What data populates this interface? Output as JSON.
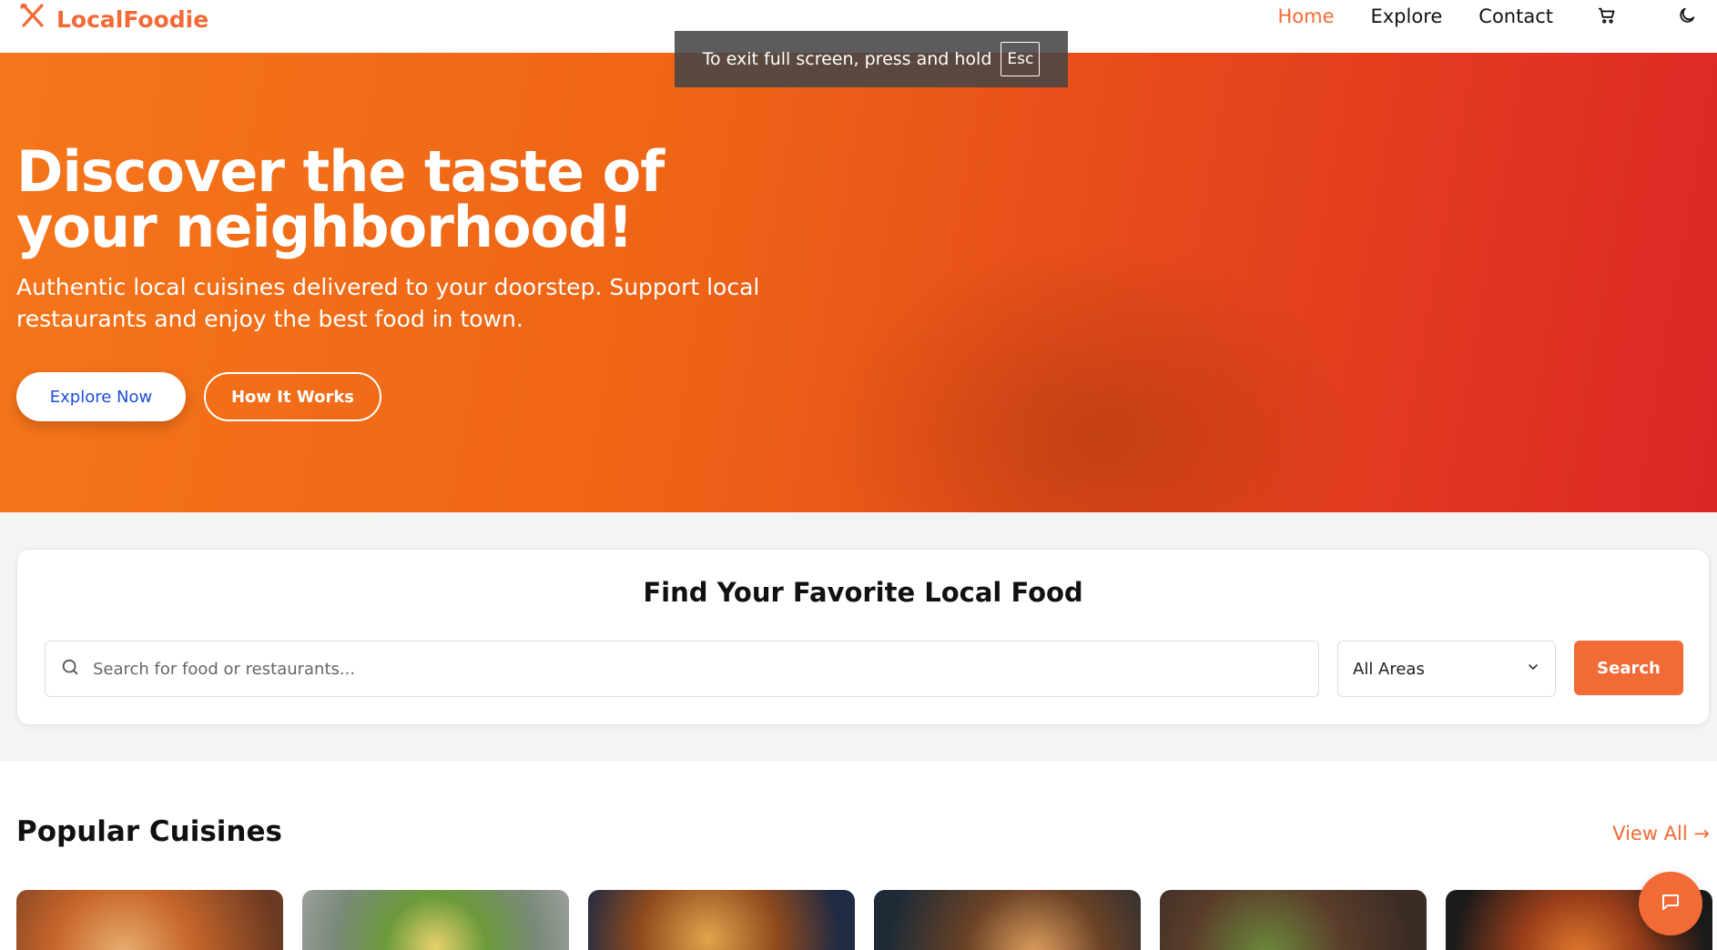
{
  "brand": {
    "name": "LocalFoodie"
  },
  "nav": {
    "links": [
      "Home",
      "Explore",
      "Contact"
    ],
    "active": "Home"
  },
  "fullscreen_toast": {
    "text": "To exit full screen, press and hold",
    "key": "Esc"
  },
  "hero": {
    "title": "Discover the taste of your neighborhood!",
    "subtitle": "Authentic local cuisines delivered to your doorstep. Support local restaurants and enjoy the best food in town.",
    "primary_button": "Explore Now",
    "secondary_button": "How It Works"
  },
  "search": {
    "title": "Find Your Favorite Local Food",
    "placeholder": "Search for food or restaurants...",
    "area_selected": "All Areas",
    "button": "Search"
  },
  "cuisines": {
    "title": "Popular Cuisines",
    "view_all": "View All →"
  },
  "colors": {
    "accent": "#f26a35",
    "hero_start": "#f5761a",
    "hero_end": "#dc2626"
  },
  "icons": {
    "brand": "fork-knife-icon",
    "cart": "cart-icon",
    "theme": "moon-icon",
    "search": "search-icon",
    "select": "chevron-down-icon",
    "chat": "chat-icon"
  }
}
